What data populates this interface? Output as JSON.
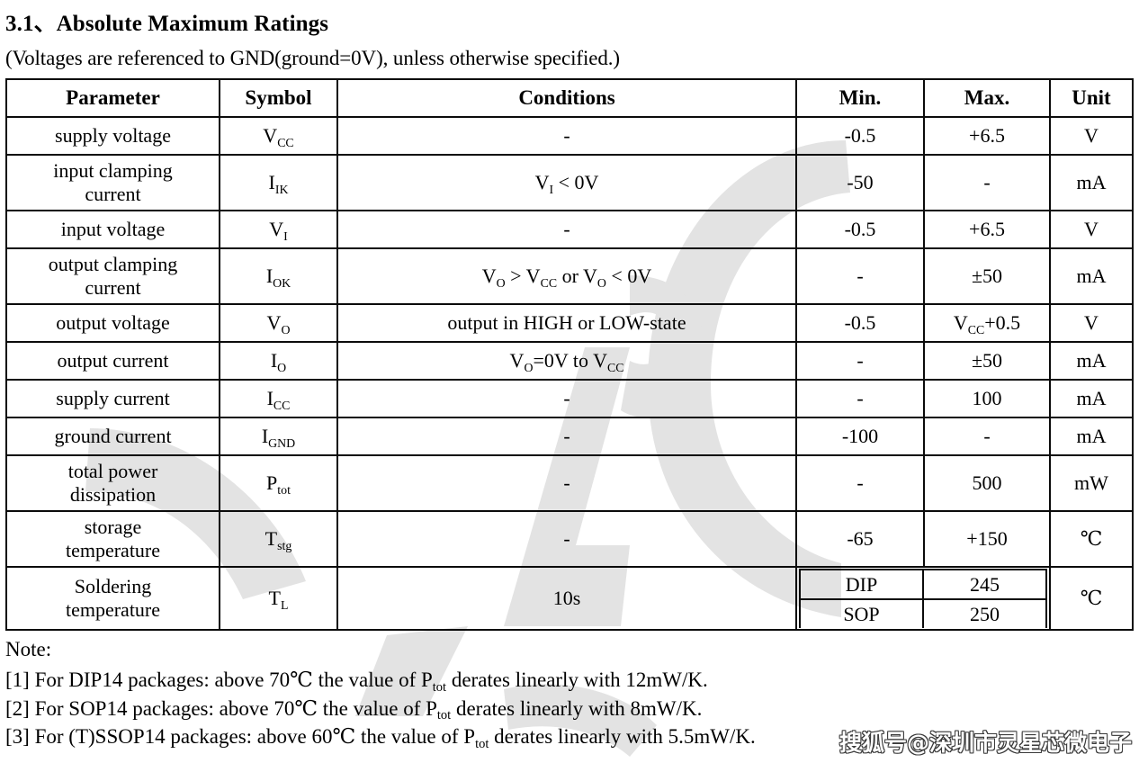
{
  "document": {
    "section_number": "3.1、",
    "section_title": "Absolute Maximum Ratings",
    "subtitle": "(Voltages are referenced to GND(ground=0V), unless otherwise specified.)"
  },
  "table": {
    "headers": {
      "parameter": "Parameter",
      "symbol": "Symbol",
      "conditions": "Conditions",
      "min": "Min.",
      "max": "Max.",
      "unit": "Unit"
    },
    "rows": [
      {
        "parameter": "supply voltage",
        "symbol_base": "V",
        "symbol_sub": "CC",
        "conditions": "-",
        "min": "-0.5",
        "max": "+6.5",
        "unit": "V"
      },
      {
        "parameter": "input clamping current",
        "symbol_base": "I",
        "symbol_sub": "IK",
        "conditions": "VI < 0V",
        "min": "-50",
        "max": "-",
        "unit": "mA"
      },
      {
        "parameter": "input voltage",
        "symbol_base": "V",
        "symbol_sub": "I",
        "conditions": "-",
        "min": "-0.5",
        "max": "+6.5",
        "unit": "V"
      },
      {
        "parameter": "output clamping current",
        "symbol_base": "I",
        "symbol_sub": "OK",
        "conditions": "VO > VCC or VO < 0V",
        "min": "-",
        "max": "±50",
        "unit": "mA"
      },
      {
        "parameter": "output voltage",
        "symbol_base": "V",
        "symbol_sub": "O",
        "conditions": "output in HIGH or LOW-state",
        "min": "-0.5",
        "max": "VCC+0.5",
        "unit": "V"
      },
      {
        "parameter": "output current",
        "symbol_base": "I",
        "symbol_sub": "O",
        "conditions": "VO=0V to VCC",
        "min": "-",
        "max": "±50",
        "unit": "mA"
      },
      {
        "parameter": "supply current",
        "symbol_base": "I",
        "symbol_sub": "CC",
        "conditions": "-",
        "min": "-",
        "max": "100",
        "unit": "mA"
      },
      {
        "parameter": "ground current",
        "symbol_base": "I",
        "symbol_sub": "GND",
        "conditions": "-",
        "min": "-100",
        "max": "-",
        "unit": "mA"
      },
      {
        "parameter": "total power dissipation",
        "symbol_base": "P",
        "symbol_sub": "tot",
        "conditions": "-",
        "min": "-",
        "max": "500",
        "unit": "mW"
      },
      {
        "parameter": "storage temperature",
        "symbol_base": "T",
        "symbol_sub": "stg",
        "conditions": "-",
        "min": "-65",
        "max": "+150",
        "unit": "℃"
      }
    ],
    "soldering_row": {
      "parameter": "Soldering temperature",
      "symbol_base": "T",
      "symbol_sub": "L",
      "time": "10s",
      "unit": "℃",
      "packages": [
        {
          "name": "DIP",
          "value": "245"
        },
        {
          "name": "SOP",
          "value": "250"
        }
      ]
    },
    "symbol_parts": {
      "r0": {
        "base": "V",
        "sub": "CC"
      },
      "r1": {
        "base": "I",
        "sub": "IK"
      },
      "r2": {
        "base": "V",
        "sub": "I"
      },
      "r3": {
        "base": "I",
        "sub": "OK"
      },
      "r4": {
        "base": "V",
        "sub": "O"
      },
      "r5": {
        "base": "I",
        "sub": "O"
      },
      "r6": {
        "base": "I",
        "sub": "CC"
      },
      "r7": {
        "base": "I",
        "sub": "GND"
      },
      "r8": {
        "base": "P",
        "sub": "tot"
      },
      "r9": {
        "base": "T",
        "sub": "stg"
      }
    },
    "cells": {
      "r0": {
        "param": "supply voltage",
        "cond": "-",
        "min": "-0.5",
        "max": "+6.5",
        "unit": "V"
      },
      "r1": {
        "param_l1": "input clamping",
        "param_l2": "current",
        "cond_pre": "V",
        "cond_sub": "I",
        "cond_post": " < 0V",
        "min": "-50",
        "max": "-",
        "unit": "mA"
      },
      "r2": {
        "param": "input voltage",
        "cond": "-",
        "min": "-0.5",
        "max": "+6.5",
        "unit": "V"
      },
      "r3": {
        "param_l1": "output clamping",
        "param_l2": "current",
        "min": "-",
        "max": "±50",
        "unit": "mA"
      },
      "r4": {
        "param": "output voltage",
        "cond": "output in HIGH or LOW-state",
        "min": "-0.5",
        "max_pre": "V",
        "max_sub": "CC",
        "max_post": "+0.5",
        "unit": "V"
      },
      "r5": {
        "param": "output current",
        "min": "-",
        "max": "±50",
        "unit": "mA"
      },
      "r6": {
        "param": "supply current",
        "cond": "-",
        "min": "-",
        "max": "100",
        "unit": "mA"
      },
      "r7": {
        "param": "ground current",
        "cond": "-",
        "min": "-100",
        "max": "-",
        "unit": "mA"
      },
      "r8": {
        "param_l1": "total power",
        "param_l2": "dissipation",
        "cond": "-",
        "min": "-",
        "max": "500",
        "unit": "mW"
      },
      "r9": {
        "param_l1": "storage",
        "param_l2": "temperature",
        "cond": "-",
        "min": "-65",
        "max": "+150",
        "unit": "℃"
      },
      "r10": {
        "param_l1": "Soldering",
        "param_l2": "temperature",
        "time": "10s",
        "unit": "℃",
        "dip_label": "DIP",
        "dip_value": "245",
        "sop_label": "SOP",
        "sop_value": "250"
      }
    }
  },
  "notes": {
    "heading": "Note:",
    "items": [
      {
        "index": "[1]",
        "pre": "For DIP14 packages: above 70℃ the value of P",
        "sub": "tot",
        "post": " derates linearly with 12mW/K."
      },
      {
        "index": "[2]",
        "pre": "For SOP14 packages: above 70℃ the value of P",
        "sub": "tot",
        "post": " derates linearly with 8mW/K."
      },
      {
        "index": "[3]",
        "pre": "For (T)SSOP14 packages: above 60℃ the value of P",
        "sub": "tot",
        "post": " derates linearly with 5.5mW/K."
      }
    ]
  },
  "watermark": {
    "brand_text": "搜狐号@深圳市灵星芯微电子",
    "background_color": "#e2e2e2"
  }
}
